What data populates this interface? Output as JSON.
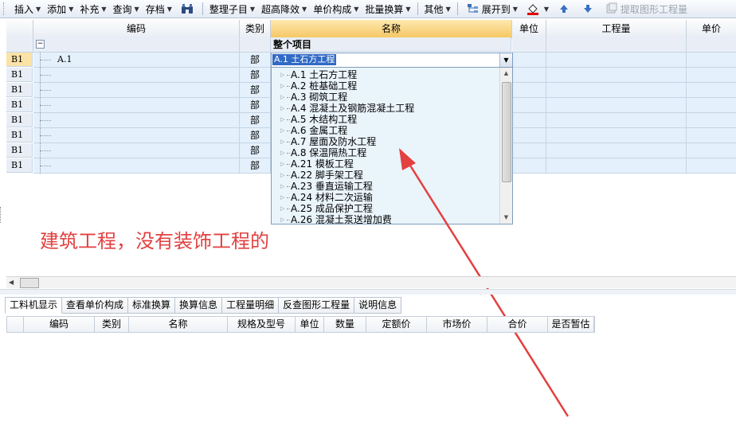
{
  "toolbar": {
    "insert": "插入",
    "add": "添加",
    "supplement": "补充",
    "query": "查询",
    "store": "存档",
    "organize": "整理子目",
    "overheight": "超高降效",
    "unit_price": "单价构成",
    "batch_convert": "批量换算",
    "other": "其他",
    "expand_to": "展开到",
    "extract": "提取图形工程量"
  },
  "grid": {
    "headers": {
      "code": "编码",
      "type": "类别",
      "name": "名称",
      "unit": "单位",
      "quantity": "工程量",
      "price": "单价"
    },
    "group_label": "整个项目",
    "rows": [
      {
        "row": "B1",
        "code": "A.1",
        "type": "部"
      },
      {
        "row": "B1",
        "code": "",
        "type": "部"
      },
      {
        "row": "B1",
        "code": "",
        "type": "部"
      },
      {
        "row": "B1",
        "code": "",
        "type": "部"
      },
      {
        "row": "B1",
        "code": "",
        "type": "部"
      },
      {
        "row": "B1",
        "code": "",
        "type": "部"
      },
      {
        "row": "B1",
        "code": "",
        "type": "部"
      },
      {
        "row": "B1",
        "code": "",
        "type": "部"
      }
    ]
  },
  "combo": {
    "value": "A.1 土石方工程"
  },
  "dropdown": {
    "items": [
      "A.1 土石方工程",
      "A.2 桩基础工程",
      "A.3 砌筑工程",
      "A.4 混凝土及钢筋混凝土工程",
      "A.5 木结构工程",
      "A.6 金属工程",
      "A.7 屋面及防水工程",
      "A.8 保温隔热工程",
      "A.21 模板工程",
      "A.22 脚手架工程",
      "A.23 垂直运输工程",
      "A.24 材料二次运输",
      "A.25 成品保护工程",
      "A.26 混凝土泵送增加费"
    ]
  },
  "annotation": {
    "text": "建筑工程，没有装饰工程的",
    "color": "#e34040"
  },
  "bottom": {
    "tabs": [
      "工料机显示",
      "查看单价构成",
      "标准换算",
      "换算信息",
      "工程量明细",
      "反查图形工程量",
      "说明信息"
    ],
    "headers": [
      "编码",
      "类别",
      "名称",
      "规格及型号",
      "单位",
      "数量",
      "定额价",
      "市场价",
      "合价",
      "是否暂估"
    ]
  }
}
